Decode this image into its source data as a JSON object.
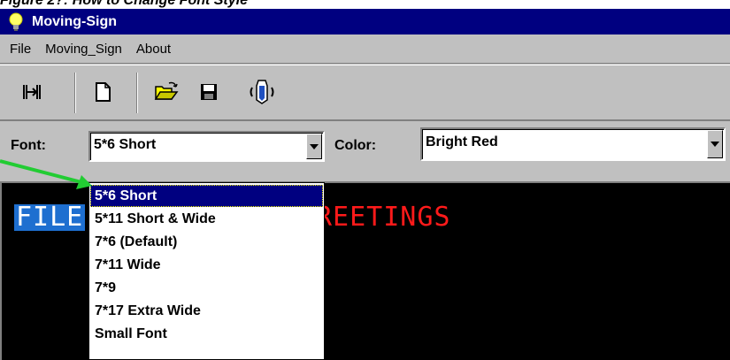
{
  "caption": "Figure 2?: How to Change Font Style",
  "window": {
    "title": "Moving-Sign"
  },
  "menu": [
    "File",
    "Moving_Sign",
    "About"
  ],
  "toolbar": {
    "buttons": [
      "connect-icon",
      "new-icon",
      "open-icon",
      "save-icon",
      "send-icon"
    ]
  },
  "font_label": "Font:",
  "font_value": "5*6 Short",
  "color_label": "Color:",
  "color_value": "Bright Red",
  "display": {
    "selected_text": "FILE",
    "red_text": "REETINGS",
    "text_color": "#ff1a1a"
  },
  "font_options": [
    "5*6 Short",
    "5*11 Short & Wide",
    "7*6 (Default)",
    "7*11 Wide",
    "7*9",
    "7*17 Extra Wide",
    "Small  Font"
  ],
  "colors": {
    "titlebar": "#000080",
    "accent_arrow": "#22cc33",
    "selection": "#1e6fd0"
  }
}
